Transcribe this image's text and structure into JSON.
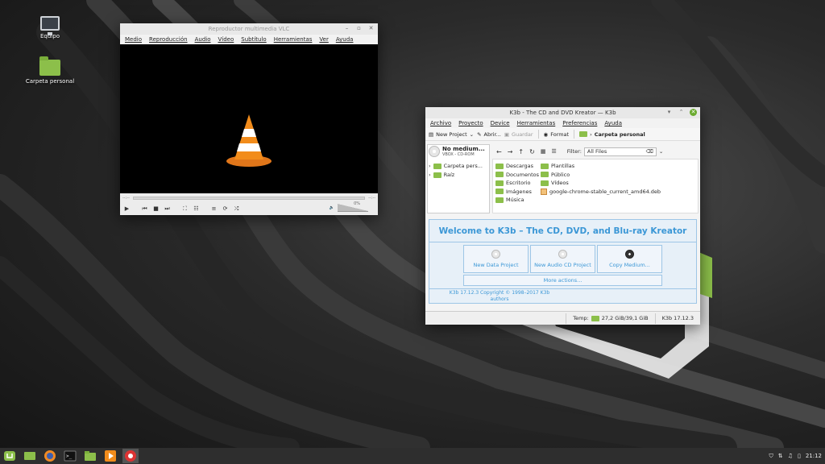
{
  "desktop": {
    "icons": [
      {
        "label": "Equipo"
      },
      {
        "label": "Carpeta personal"
      }
    ]
  },
  "vlc": {
    "title": "Reproductor multimedia VLC",
    "menu": [
      "Medio",
      "Reproducción",
      "Audio",
      "Vídeo",
      "Subtítulo",
      "Herramientas",
      "Ver",
      "Ayuda"
    ],
    "time_elapsed": "--:--",
    "time_total": "--:--",
    "volume": "0%"
  },
  "k3b": {
    "title": "K3b - The CD and DVD Kreator — K3b",
    "menu": [
      "Archivo",
      "Proyecto",
      "Device",
      "Herramientas",
      "Preferencias",
      "Ayuda"
    ],
    "toolbar": {
      "new_project": "New Project",
      "open": "Abrir...",
      "save": "Guardar",
      "format": "Format",
      "breadcrumb": "Carpeta personal"
    },
    "device": {
      "name": "No medium...",
      "sub": "VBOX - CD-ROM"
    },
    "tree": [
      "Carpeta pers...",
      "Raíz"
    ],
    "filter": {
      "label": "Filter:",
      "value": "All Files"
    },
    "files": [
      {
        "name": "Descargas",
        "type": "folder"
      },
      {
        "name": "Plantillas",
        "type": "folder"
      },
      {
        "name": "Documentos",
        "type": "folder"
      },
      {
        "name": "Público",
        "type": "folder"
      },
      {
        "name": "Escritorio",
        "type": "folder"
      },
      {
        "name": "Vídeos",
        "type": "folder"
      },
      {
        "name": "Imágenes",
        "type": "folder"
      },
      {
        "name": "google-chrome-stable_current_amd64.deb",
        "type": "deb"
      },
      {
        "name": "Música",
        "type": "folder"
      }
    ],
    "welcome": {
      "heading": "Welcome to K3b – The CD, DVD, and Blu-ray Kreator",
      "buttons": [
        "New Data Project",
        "New Audio CD Project",
        "Copy Medium..."
      ],
      "more": "More actions...",
      "copyright": "K3b 17.12.3 Copyright © 1998–2017 K3b authors"
    },
    "status": {
      "temp_label": "Temp:",
      "temp_value": "27,2 GiB/39,1 GiB",
      "version": "K3b 17.12.3"
    }
  },
  "taskbar": {
    "clock": "21:12"
  },
  "colors": {
    "mint_green": "#8cbf4a",
    "k3b_blue": "#3b97d6",
    "vlc_orange": "#f28c1b"
  }
}
